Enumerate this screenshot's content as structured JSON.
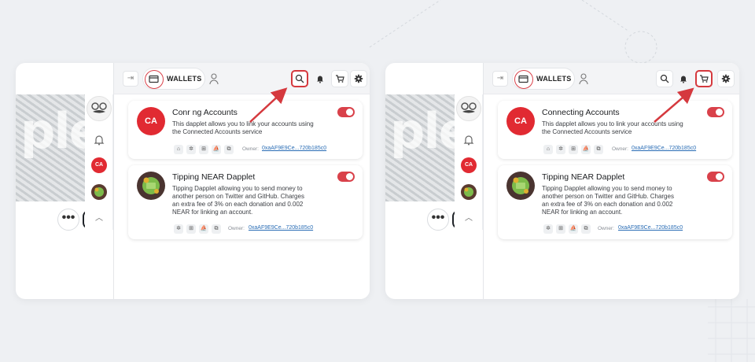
{
  "screens": [
    {
      "side": "left",
      "hero_text": "plet",
      "rail": {
        "ca_label": "CA",
        "more_label": "•••",
        "up_label": "︿"
      },
      "topbar": {
        "exit_icon": "⇥",
        "wallet_label": "WALLETS"
      },
      "cards": [
        {
          "avatar_label": "CA",
          "title": "Conr        ng Accounts",
          "description": "This dapplet allows you to link your accounts using the Connected Accounts service",
          "owner_label": "Owner:",
          "owner_value": "0xaAF9E9Ce...720b185c0"
        },
        {
          "avatar_label": "",
          "title": "Tipping NEAR Dapplet",
          "description": "Tipping Dapplet allowing you to send money to another person on Twitter and GitHub. Charges an extra fee of 3% on each donation and 0.002 NEAR for linking an account.",
          "owner_label": "Owner:",
          "owner_value": "0xaAF9E9Ce...720b185c0"
        }
      ],
      "highlighted_icon": "search-icon"
    },
    {
      "side": "right",
      "hero_text": "plet",
      "rail": {
        "ca_label": "CA",
        "more_label": "•••",
        "up_label": "︿"
      },
      "topbar": {
        "exit_icon": "⇥",
        "wallet_label": "WALLETS"
      },
      "cards": [
        {
          "avatar_label": "CA",
          "title": "Connecting Accounts",
          "description": "This dapplet allows you to link your accounts using the Connected Accounts service",
          "owner_label": "Owner:",
          "owner_value": "0xaAF9E9Ce...720b185c0"
        },
        {
          "avatar_label": "",
          "title": "Tipping NEAR Dapplet",
          "description": "Tipping Dapplet allowing you to send money to another person on Twitter and GitHub. Charges an extra fee of 3% on each donation and 0.002 NEAR for linking an account.",
          "owner_label": "Owner:",
          "owner_value": "0xaAF9E9Ce...720b185c0"
        }
      ],
      "highlighted_icon": "cart-icon"
    }
  ],
  "colors": {
    "accent": "#d9414a",
    "highlight": "#d5393e",
    "link": "#2a6db5",
    "background": "#eef0f3"
  },
  "chip_icons": [
    "home-icon",
    "gear-icon",
    "cart-icon",
    "ship-icon",
    "copy-icon"
  ]
}
